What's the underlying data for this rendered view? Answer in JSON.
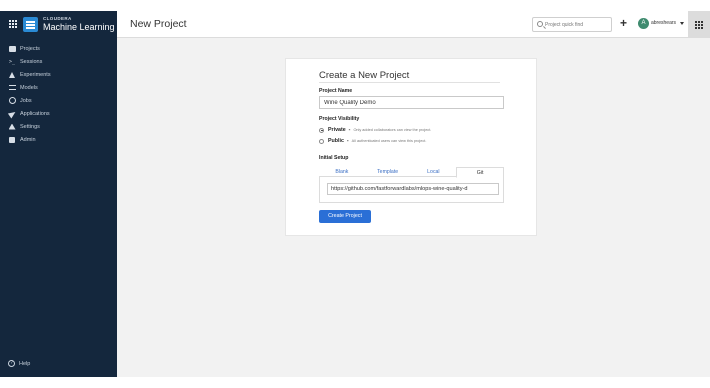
{
  "brand": {
    "small": "CLOUDERA",
    "big": "Machine Learning"
  },
  "header": {
    "title": "New Project",
    "search_placeholder": "Project quick find",
    "add_label": "+",
    "avatar_initial": "A",
    "username": "abreshears"
  },
  "sidebar": {
    "items": [
      {
        "label": "Projects",
        "icon": "projects-icon"
      },
      {
        "label": "Sessions",
        "icon": "terminal-icon"
      },
      {
        "label": "Experiments",
        "icon": "flask-icon"
      },
      {
        "label": "Models",
        "icon": "models-icon"
      },
      {
        "label": "Jobs",
        "icon": "clock-icon"
      },
      {
        "label": "Applications",
        "icon": "paper-plane-icon"
      },
      {
        "label": "Settings",
        "icon": "settings-icon"
      },
      {
        "label": "Admin",
        "icon": "lock-icon"
      }
    ],
    "help": "Help",
    "help_glyph": "?"
  },
  "form": {
    "title": "Create a New Project",
    "name_label": "Project Name",
    "name_value": "Wine Quality Demo",
    "visibility_label": "Project Visibility",
    "visibility": [
      {
        "label": "Private",
        "marker": "-",
        "desc": "Only added collaborators can view the project.",
        "selected": true
      },
      {
        "label": "Public",
        "marker": "-",
        "desc": "All authenticated users can view this project.",
        "selected": false
      }
    ],
    "setup_label": "Initial Setup",
    "tabs": [
      "Blank",
      "Template",
      "Local",
      "Git"
    ],
    "active_tab": "Git",
    "git_url": "https://github.com/fastforwardlabs/mlops-wine-quality-d",
    "submit_label": "Create Project"
  },
  "colors": {
    "sidebar_bg": "#14273d",
    "accent": "#2a6fd6",
    "content_bg": "#f2f2f2"
  }
}
